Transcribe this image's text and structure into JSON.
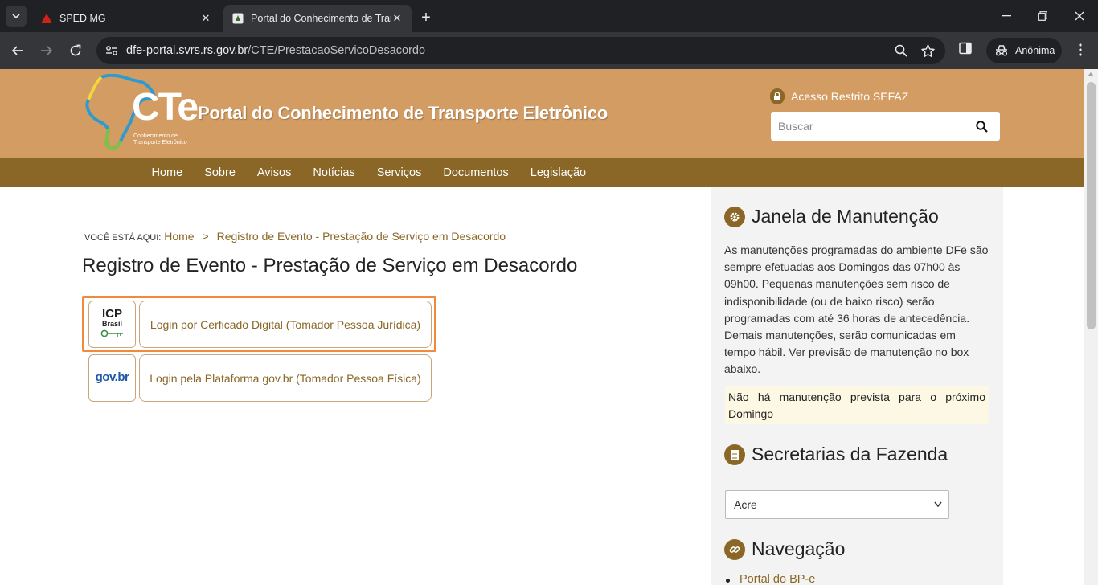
{
  "browser": {
    "tabs": [
      {
        "title": "SPED MG",
        "active": false
      },
      {
        "title": "Portal do Conhecimento de Transporte Eletrônico",
        "active": true
      }
    ],
    "url_host": "dfe-portal.svrs.rs.gov.br",
    "url_path": "/CTE/PrestacaoServicoDesacordo",
    "profile_label": "Anônima"
  },
  "header": {
    "site_title": "Portal do Conhecimento de Transporte Eletrônico",
    "logo_text": "CTe",
    "logo_sub_1": "Conhecimento de",
    "logo_sub_2": "Transporte Eletrônico",
    "restricted_label": "Acesso Restrito SEFAZ",
    "search_placeholder": "Buscar"
  },
  "menu": {
    "items": [
      "Home",
      "Sobre",
      "Avisos",
      "Notícias",
      "Serviços",
      "Documentos",
      "Legislação"
    ]
  },
  "breadcrumb": {
    "prefix": "VOCÊ ESTÁ AQUI:",
    "home": "Home",
    "separator": ">",
    "current": "Registro de Evento - Prestação de Serviço em Desacordo"
  },
  "main": {
    "page_title": "Registro de Evento - Prestação de Serviço em Desacordo",
    "icp_label_1": "ICP",
    "icp_label_2": "Brasil",
    "govbr_label": "gov.br",
    "login_certificate": "Login por Cerficado Digital (Tomador Pessoa Jurídica)",
    "login_govbr": "Login pela Plataforma gov.br (Tomador Pessoa Física)"
  },
  "sidebar": {
    "maintenance_title": "Janela de Manutenção",
    "maintenance_text": "As manutenções programadas do ambiente DFe são sempre efetuadas aos Domingos das 07h00 às 09h00. Pequenas manutenções sem risco de indisponibilidade (ou de baixo risco) serão programadas com até 36 horas de antecedência. Demais manutenções, serão comunicadas em tempo hábil. Ver previsão de manutenção no box abaixo.",
    "maintenance_notice": "Não há manutenção prevista para o próximo Domingo",
    "secretarias_title": "Secretarias da Fazenda",
    "state_selected": "Acre",
    "navigation_title": "Navegação",
    "navigation_items": [
      "Portal do BP-e"
    ]
  },
  "colors": {
    "header_bg": "#d39c62",
    "menu_bg": "#8a6726",
    "accent_text": "#8a6726",
    "highlight_border": "#f08a3c",
    "notice_bg": "#fcf8e3"
  }
}
